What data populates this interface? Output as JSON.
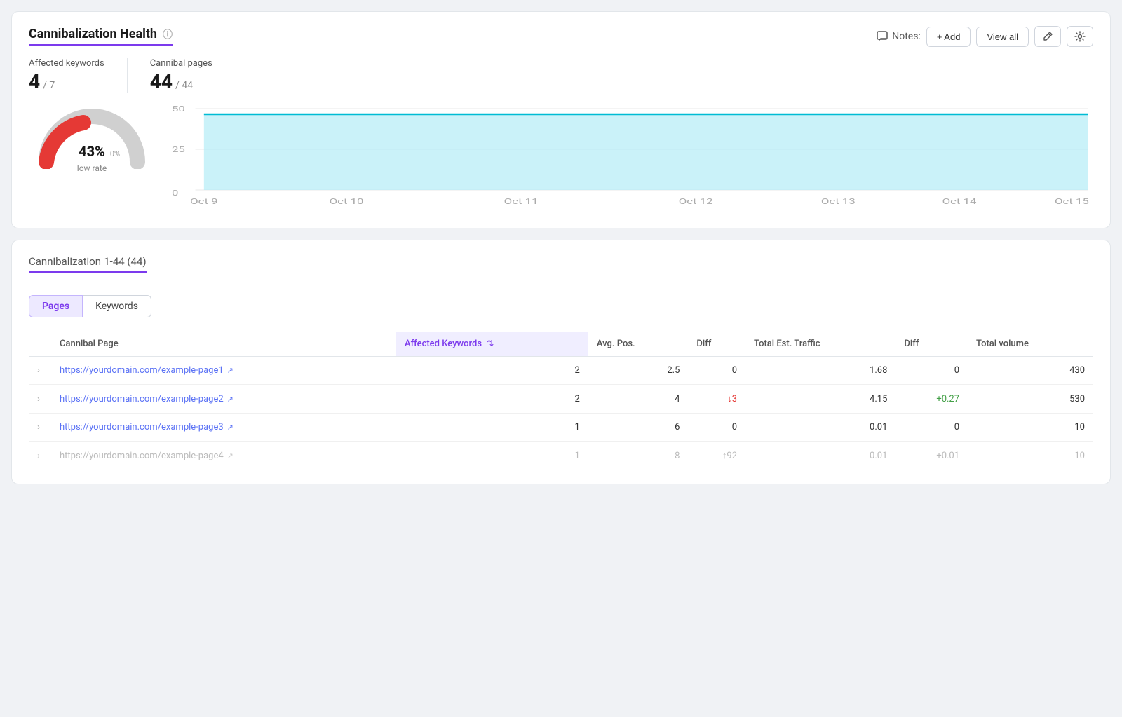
{
  "header": {
    "title": "Cannibalization Health",
    "info_tooltip": "Info",
    "notes_label": "Notes:",
    "add_label": "+ Add",
    "view_all_label": "View all"
  },
  "stats": {
    "affected_keywords_label": "Affected keywords",
    "affected_keywords_value": "4",
    "affected_keywords_total": "/ 7",
    "cannibal_pages_label": "Cannibal pages",
    "cannibal_pages_value": "44",
    "cannibal_pages_total": "/ 44"
  },
  "gauge": {
    "percentage": "43%",
    "change": "0%",
    "rate_label": "low rate"
  },
  "chart": {
    "x_labels": [
      "Oct 9",
      "Oct 10",
      "Oct 11",
      "Oct 12",
      "Oct 13",
      "Oct 14",
      "Oct 15"
    ],
    "y_labels": [
      "0",
      "25",
      "50"
    ],
    "color_line": "#00bcd4",
    "color_fill": "#b3ecf7"
  },
  "table_section": {
    "title": "Cannibalization",
    "range": "1-44 (44)"
  },
  "tabs": [
    {
      "label": "Pages",
      "active": true
    },
    {
      "label": "Keywords",
      "active": false
    }
  ],
  "table": {
    "columns": [
      {
        "label": "",
        "key": "expand"
      },
      {
        "label": "Cannibal Page",
        "key": "page"
      },
      {
        "label": "Affected Keywords",
        "key": "keywords",
        "sortable": true,
        "active": true
      },
      {
        "label": "Avg. Pos.",
        "key": "avg_pos"
      },
      {
        "label": "Diff",
        "key": "diff"
      },
      {
        "label": "Total Est. Traffic",
        "key": "traffic"
      },
      {
        "label": "Diff",
        "key": "traffic_diff"
      },
      {
        "label": "Total volume",
        "key": "volume"
      }
    ],
    "rows": [
      {
        "page": "https://yourdomain.com/example-page1",
        "keywords": "2",
        "avg_pos": "2.5",
        "diff": "0",
        "diff_type": "zero",
        "traffic": "1.68",
        "traffic_diff": "0",
        "traffic_diff_type": "zero",
        "volume": "430"
      },
      {
        "page": "https://yourdomain.com/example-page2",
        "keywords": "2",
        "avg_pos": "4",
        "diff": "↓3",
        "diff_type": "neg",
        "traffic": "4.15",
        "traffic_diff": "+0.27",
        "traffic_diff_type": "pos",
        "volume": "530"
      },
      {
        "page": "https://yourdomain.com/example-page3",
        "keywords": "1",
        "avg_pos": "6",
        "diff": "0",
        "diff_type": "zero",
        "traffic": "0.01",
        "traffic_diff": "0",
        "traffic_diff_type": "zero",
        "volume": "10"
      },
      {
        "page": "https://yourdomain.com/example-page4",
        "keywords": "1",
        "avg_pos": "8",
        "diff": "↑92",
        "diff_type": "pos",
        "traffic": "0.01",
        "traffic_diff": "+0.01",
        "traffic_diff_type": "pos",
        "volume": "10",
        "faded": true
      }
    ]
  }
}
